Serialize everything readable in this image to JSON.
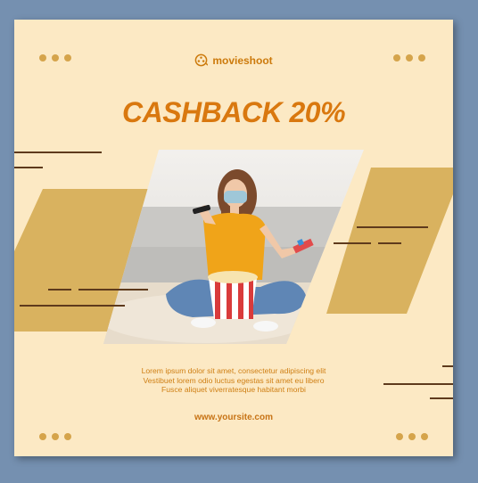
{
  "brand": {
    "name": "movieshoot",
    "logo_icon": "film-reel-icon"
  },
  "headline": "CASHBACK 20%",
  "body_text": [
    "Lorem ipsum dolor sit amet, consectetur adipiscing elit",
    "Vestibuet lorem odio luctus egestas sit amet eu libero",
    "Fusce aliquet viverratesque habitant morbi"
  ],
  "website": "www.yoursite.com",
  "colors": {
    "card_background": "#fce9c4",
    "accent_orange": "#d9780f",
    "accent_gold": "#d5a44b",
    "line_brown": "#5e3a1c",
    "page_background": "#7590b0"
  },
  "photo": {
    "icon": "woman-with-remote-and-popcorn-photo"
  }
}
